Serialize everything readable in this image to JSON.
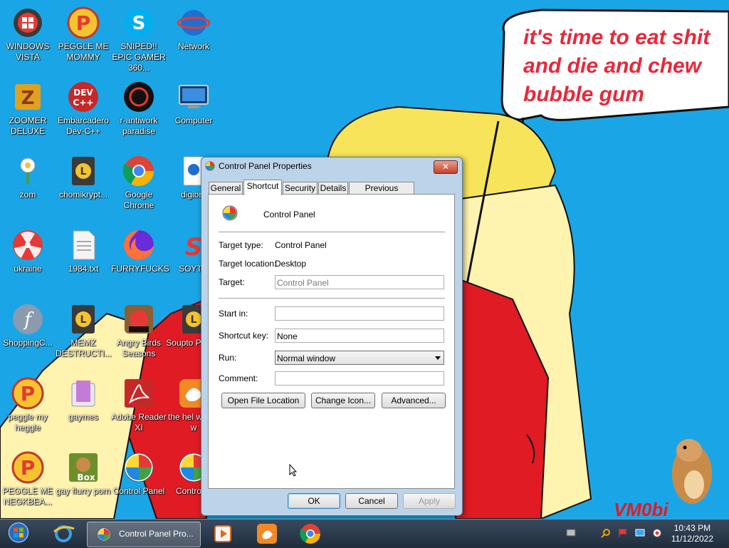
{
  "desktop": {
    "bubble_text": "it's time to eat shit and die and chew bubble gum",
    "watermark": "VM0bi",
    "icons": [
      {
        "label": "WINDOWS VISTA",
        "icon": "vista-orb-icon"
      },
      {
        "label": "PEGGLE ME MOMMY",
        "icon": "peggle-icon"
      },
      {
        "label": "SNIPED!! EPIC GAMER 360...",
        "icon": "skype-icon"
      },
      {
        "label": "Network",
        "icon": "network-icon"
      },
      {
        "label": "ZOOMER DELUXE",
        "icon": "zoomer-icon"
      },
      {
        "label": "Embarcadero Dev-C++",
        "icon": "devcpp-icon"
      },
      {
        "label": "r-antiwork paradise",
        "icon": "antiwork-icon"
      },
      {
        "label": "Computer",
        "icon": "computer-icon"
      },
      {
        "label": "zom",
        "icon": "plant-icon"
      },
      {
        "label": "chomikrypt...",
        "icon": "lock-file-icon"
      },
      {
        "label": "Google Chrome",
        "icon": "chrome-icon"
      },
      {
        "label": "digibro",
        "icon": "digibro-icon"
      },
      {
        "label": "ukraine",
        "icon": "radiation-icon"
      },
      {
        "label": "1984.txt",
        "icon": "text-file-icon"
      },
      {
        "label": "FURRYFUCKS",
        "icon": "firefox-icon"
      },
      {
        "label": "SOYTO",
        "icon": "soyto-icon"
      },
      {
        "label": "ShoppingC...",
        "icon": "flash-icon"
      },
      {
        "label": "MEMZ DESTRUCTI...",
        "icon": "lock-file-icon"
      },
      {
        "label": "Angry Birds Seasons",
        "icon": "angry-birds-icon"
      },
      {
        "label": "Soupto Playse",
        "icon": "lock-file-icon"
      },
      {
        "label": "peggle my heggle",
        "icon": "peggle-icon"
      },
      {
        "label": "gaymes",
        "icon": "folder-icon"
      },
      {
        "label": "Adobe Reader XI",
        "icon": "adobe-reader-icon"
      },
      {
        "label": "the hel wrong w",
        "icon": "uc-browser-icon"
      },
      {
        "label": "PEGGLE ME NEGKBEA...",
        "icon": "peggle-icon"
      },
      {
        "label": "gay flurry porn",
        "icon": "box-icon"
      },
      {
        "label": "Control Panel",
        "icon": "control-panel-icon"
      },
      {
        "label": "Control P",
        "icon": "control-panel-icon"
      }
    ]
  },
  "dialog": {
    "title": "Control Panel Properties",
    "close_label": "✕",
    "tabs": [
      "General",
      "Shortcut",
      "Security",
      "Details",
      "Previous Versions"
    ],
    "active_tab": "Shortcut",
    "item_name": "Control Panel",
    "target_type_label": "Target type:",
    "target_type_value": "Control Panel",
    "target_location_label": "Target location:",
    "target_location_value": "Desktop",
    "target_label": "Target:",
    "target_value": "Control Panel",
    "start_in_label": "Start in:",
    "start_in_value": "",
    "shortcut_key_label": "Shortcut key:",
    "shortcut_key_value": "None",
    "run_label": "Run:",
    "run_value": "Normal window",
    "comment_label": "Comment:",
    "comment_value": "",
    "open_file_location": "Open File Location",
    "change_icon": "Change Icon...",
    "advanced": "Advanced...",
    "ok": "OK",
    "cancel": "Cancel",
    "apply": "Apply"
  },
  "taskbar": {
    "active_window_label": "Control Panel Pro...",
    "time": "10:43 PM",
    "date": "11/12/2022"
  }
}
